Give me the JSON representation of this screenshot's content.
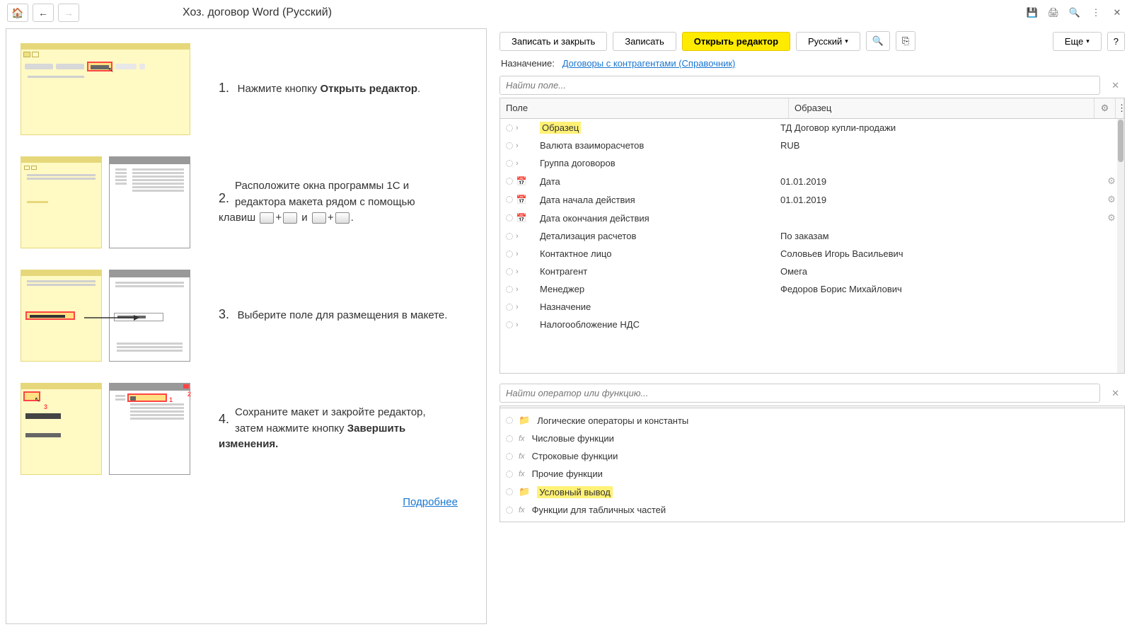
{
  "title": "Хоз. договор Word (Русский)",
  "toolbar": {
    "save_close": "Записать и закрыть",
    "save": "Записать",
    "open_editor": "Открыть редактор",
    "language": "Русский",
    "more": "Еще"
  },
  "purpose": {
    "label": "Назначение:",
    "link": "Договоры с контрагентами (Справочник)"
  },
  "search_field_placeholder": "Найти поле...",
  "search_func_placeholder": "Найти оператор или функцию...",
  "headers": {
    "field": "Поле",
    "sample": "Образец"
  },
  "rows": [
    {
      "name": "Образец",
      "sample": "ТД Договор купли-продажи",
      "highlight": true,
      "icon": ">"
    },
    {
      "name": "Валюта взаиморасчетов",
      "sample": "RUB",
      "icon": ">"
    },
    {
      "name": "Группа договоров",
      "sample": "",
      "icon": ">"
    },
    {
      "name": "Дата",
      "sample": "01.01.2019",
      "icon": "cal",
      "action": true
    },
    {
      "name": "Дата начала действия",
      "sample": "01.01.2019",
      "icon": "cal",
      "action": true
    },
    {
      "name": "Дата окончания действия",
      "sample": "",
      "icon": "cal",
      "action": true
    },
    {
      "name": "Детализация расчетов",
      "sample": "По заказам",
      "icon": ">"
    },
    {
      "name": "Контактное лицо",
      "sample": "Соловьев Игорь Васильевич",
      "icon": ">"
    },
    {
      "name": "Контрагент",
      "sample": "Омега",
      "icon": ">"
    },
    {
      "name": "Менеджер",
      "sample": "Федоров Борис Михайлович",
      "icon": ">"
    },
    {
      "name": "Назначение",
      "sample": "",
      "icon": ">"
    },
    {
      "name": "Налогообложение НДС",
      "sample": "",
      "icon": ">"
    }
  ],
  "funcs": [
    {
      "name": "Логические операторы и константы",
      "icon": "folder"
    },
    {
      "name": "Числовые функции",
      "icon": "fx"
    },
    {
      "name": "Строковые функции",
      "icon": "fx"
    },
    {
      "name": "Прочие функции",
      "icon": "fx"
    },
    {
      "name": "Условный вывод",
      "icon": "folder",
      "highlight": true
    },
    {
      "name": "Функции для табличных частей",
      "icon": "fx"
    }
  ],
  "steps": {
    "s1a": "Нажмите кнопку ",
    "s1b": "Открыть редактор",
    "s2a": "Расположите окна программы 1С и редактора макета рядом с помощью клавиш ",
    "s2b": " и ",
    "s3": "Выберите поле для размещения в макете.",
    "s4a": "Сохраните макет и закройте редактор, затем нажмите кнопку ",
    "s4b": "Завершить изменения."
  },
  "more_link": "Подробнее"
}
